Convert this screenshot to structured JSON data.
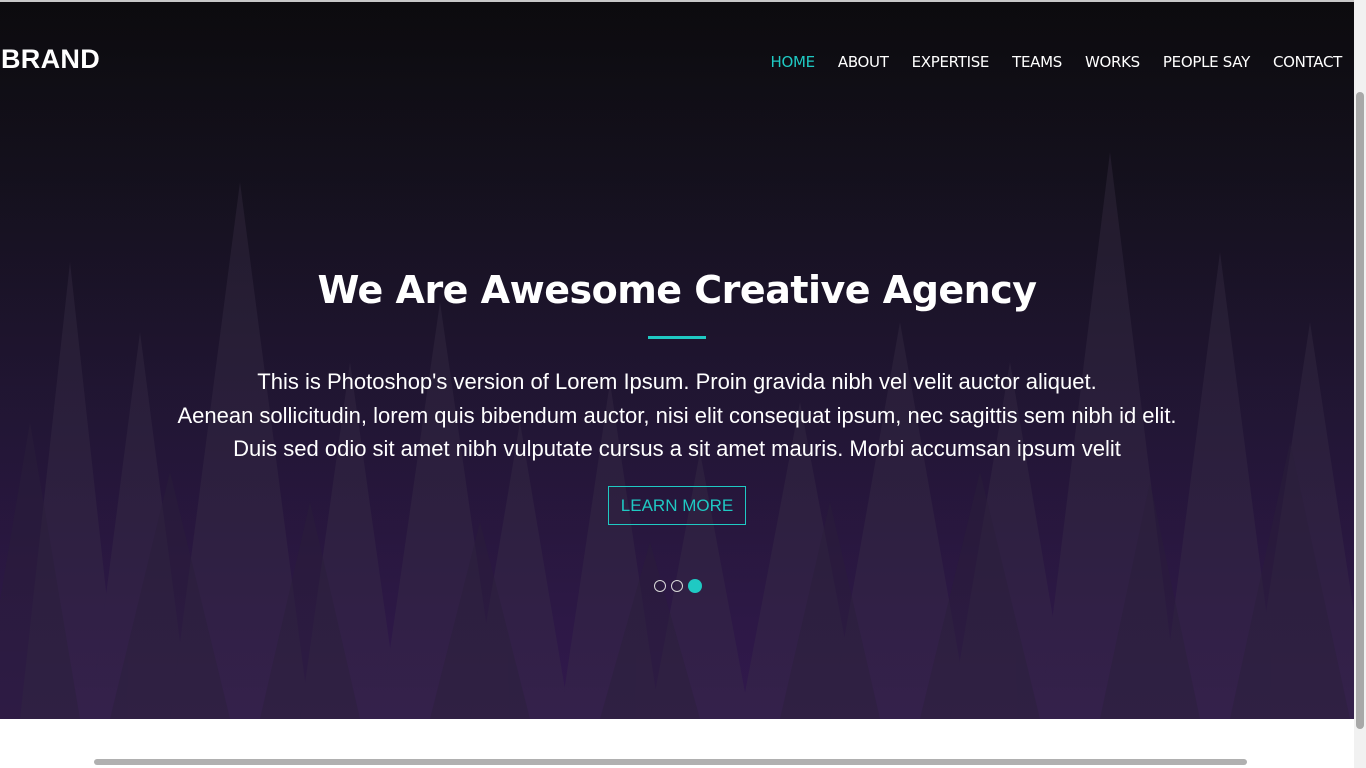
{
  "header": {
    "brand": "BRAND",
    "nav": [
      {
        "label": "HOME",
        "active": true
      },
      {
        "label": "ABOUT",
        "active": false
      },
      {
        "label": "EXPERTISE",
        "active": false
      },
      {
        "label": "TEAMS",
        "active": false
      },
      {
        "label": "WORKS",
        "active": false
      },
      {
        "label": "PEOPLE SAY",
        "active": false
      },
      {
        "label": "CONTACT",
        "active": false
      }
    ]
  },
  "hero": {
    "headline": "We Are Awesome Creative Agency",
    "description_lines": [
      "This is Photoshop's version of Lorem Ipsum. Proin gravida nibh vel velit auctor aliquet.",
      "Aenean sollicitudin, lorem quis bibendum auctor, nisi elit consequat ipsum, nec sagittis sem nibh id elit.",
      "Duis sed odio sit amet nibh vulputate cursus a sit amet mauris. Morbi accumsan ipsum velit"
    ],
    "cta_label": "LEARN MORE",
    "slides": 3,
    "active_slide": 3
  },
  "colors": {
    "accent": "#1fc9c3",
    "hero_top": "#0c0b0e",
    "hero_bottom": "#2d1548"
  }
}
